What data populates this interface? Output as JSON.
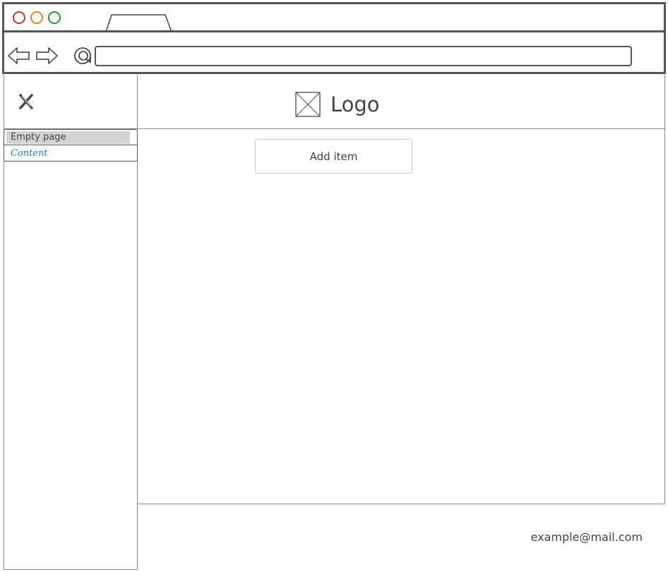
{
  "browser": {
    "window_controls": [
      "close",
      "minimize",
      "maximize"
    ],
    "tab_title": "",
    "address": ""
  },
  "header": {
    "logo_text": "Logo"
  },
  "sidebar": {
    "items": [
      {
        "label": "Empty page",
        "selected": true
      },
      {
        "label": "Content",
        "selected": false
      }
    ]
  },
  "main": {
    "add_item_label": "Add item"
  },
  "footer": {
    "email": "example@mail.com"
  },
  "colors": {
    "close_dot": "#b03a3a",
    "minimize_dot": "#d68a1a",
    "maximize_dot": "#1f9a2e",
    "selected_item_bg": "#d3d3d3",
    "link_color": "#1a80aa"
  }
}
